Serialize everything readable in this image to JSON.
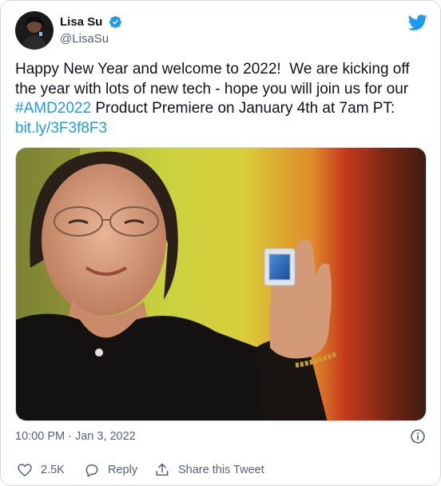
{
  "author": {
    "display_name": "Lisa Su",
    "handle": "@LisaSu",
    "verified": true
  },
  "tweet": {
    "text_before_hashtag": "Happy New Year and welcome to 2022!  We are kicking off the year with lots of new tech - hope you will join us for our ",
    "hashtag": "#AMD2022",
    "text_after_hashtag": " Product Premiere on January 4th at 7am PT: ",
    "link": "bit.ly/3F3f8F3"
  },
  "meta": {
    "timestamp": "10:00 PM · Jan 3, 2022"
  },
  "actions": {
    "like_count": "2.5K",
    "reply_label": "Reply",
    "share_label": "Share this Tweet"
  },
  "colors": {
    "link": "#1d9bf0",
    "twitter_blue": "#1d9bf0",
    "secondary_text": "#536471",
    "border": "#cfd9de"
  },
  "icons": {
    "brand": "twitter-bird-icon",
    "verified": "verified-badge-icon",
    "info": "info-icon",
    "like": "heart-icon",
    "reply": "speech-bubble-icon",
    "share": "share-icon"
  }
}
